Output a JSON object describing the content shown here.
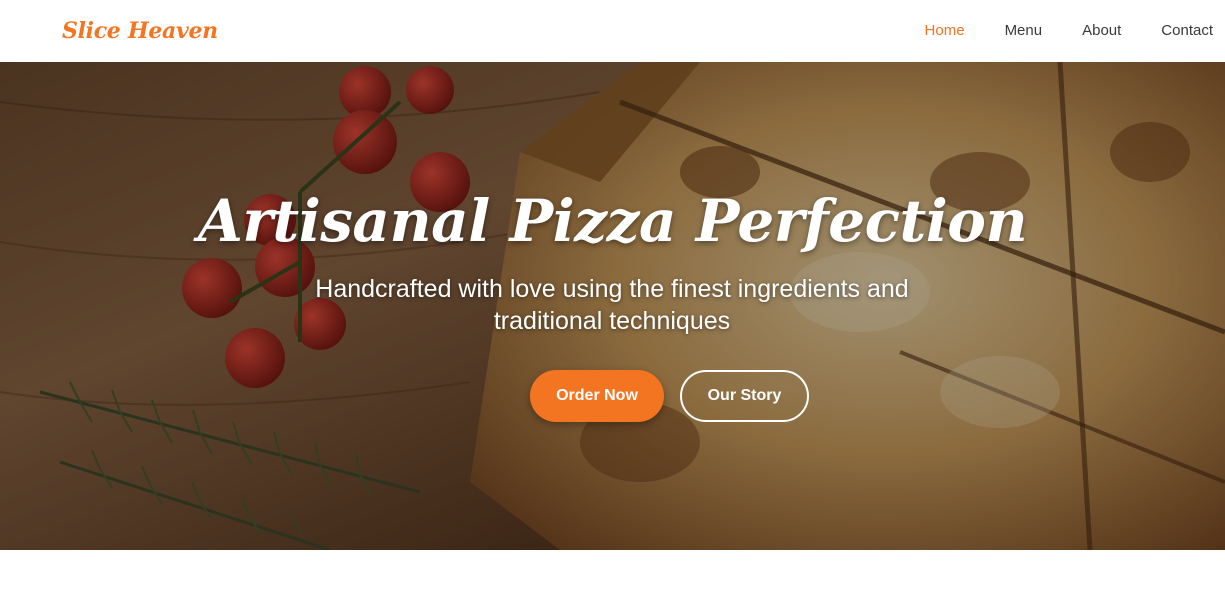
{
  "header": {
    "logo_text": "Slice Heaven",
    "nav": {
      "home": "Home",
      "menu": "Menu",
      "about": "About",
      "contact": "Contact"
    }
  },
  "hero": {
    "title": "Artisanal Pizza Perfection",
    "subtitle": "Handcrafted with love using the finest ingredients and traditional techniques",
    "primary_button": "Order Now",
    "secondary_button": "Our Story"
  },
  "colors": {
    "accent": "#f37421",
    "nav_text": "#3a3a3a",
    "hero_text": "#ffffff"
  }
}
